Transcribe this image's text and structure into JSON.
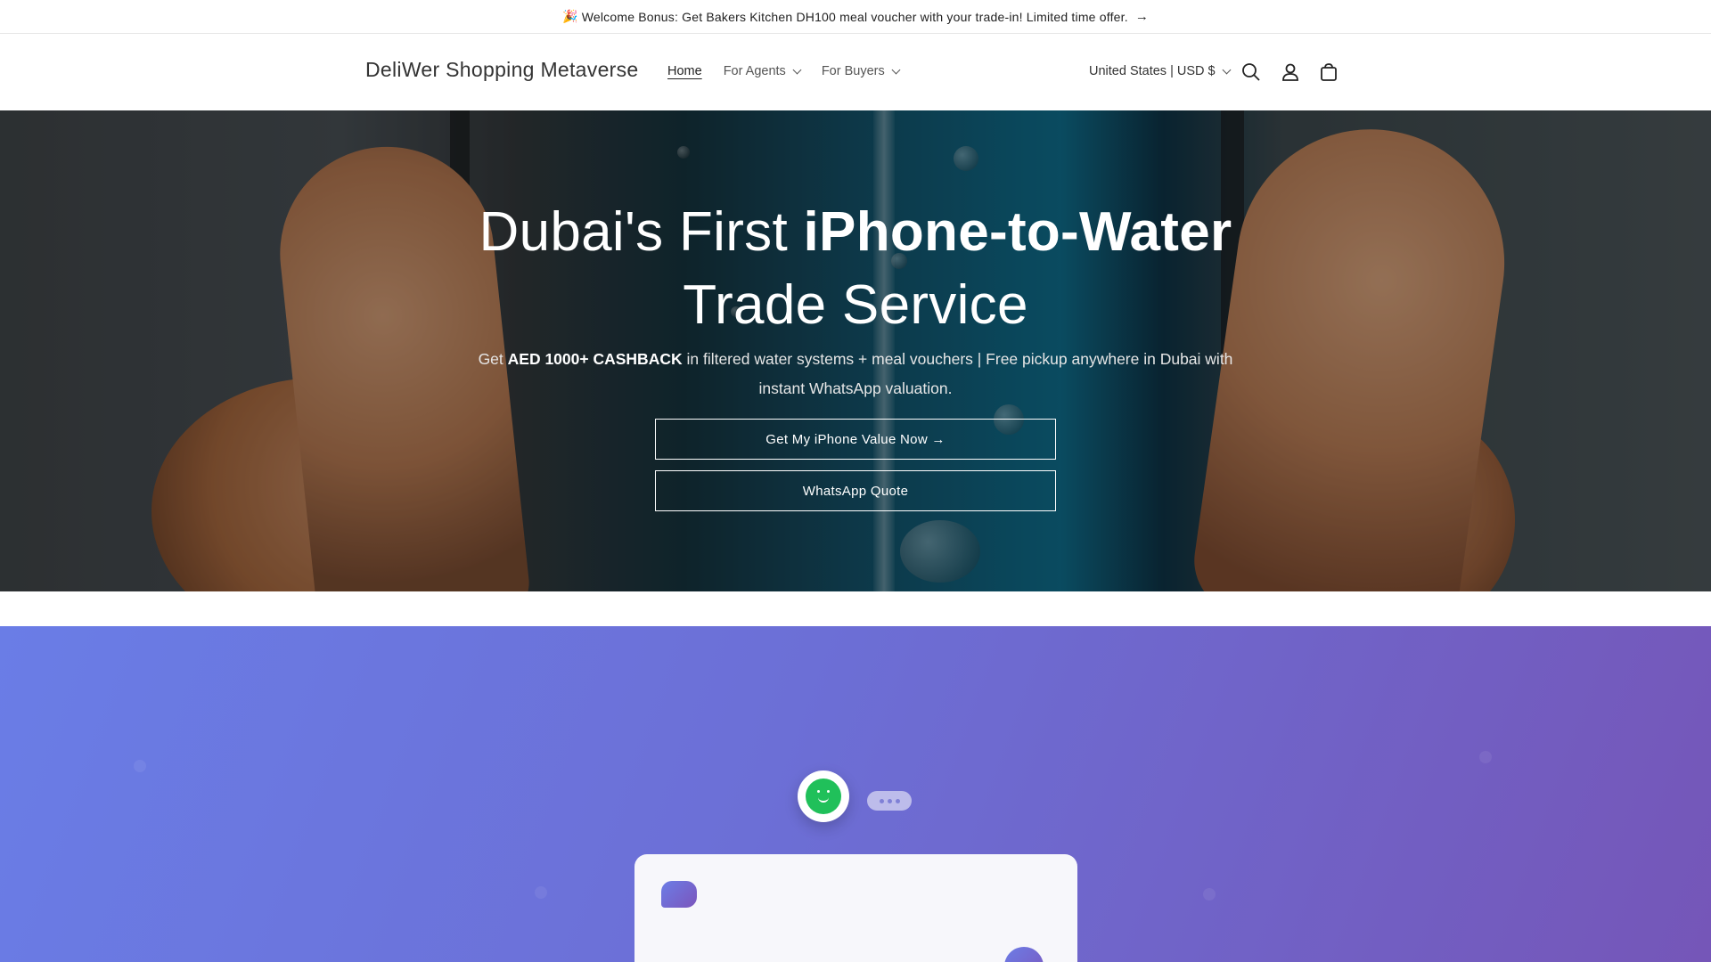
{
  "announcement": {
    "emoji": "🎉",
    "text": "Welcome Bonus: Get Bakers Kitchen DH100 meal voucher with your trade-in! Limited time offer.",
    "arrow": "→"
  },
  "header": {
    "brand": "DeliWer Shopping Metaverse",
    "nav": [
      {
        "label": "Home",
        "active": true
      },
      {
        "label": "For Agents",
        "dropdown": true
      },
      {
        "label": "For Buyers",
        "dropdown": true
      }
    ],
    "region": "United States | USD $",
    "icons": [
      "search-icon",
      "account-icon",
      "cart-icon"
    ]
  },
  "hero": {
    "title_part1": "Dubai's First ",
    "title_bold": "iPhone-to-Water",
    "title_part2": "Trade Service",
    "sub_prefix": "Get ",
    "sub_bold": "AED 1000+ CASHBACK",
    "sub_rest": " in filtered water systems + meal vouchers | Free pickup anywhere in Dubai with instant WhatsApp valuation.",
    "primary_button": "Get My iPhone Value Now →",
    "secondary_button": "WhatsApp Quote"
  },
  "chat_widget": {
    "avatar_icon": "smiley-icon",
    "typing_icon": "typing-dots-icon",
    "send_icon": "send-icon"
  },
  "colors": {
    "purple_start": "#6a7de6",
    "purple_end": "#7556b8",
    "avatar_green": "#20c05a"
  }
}
